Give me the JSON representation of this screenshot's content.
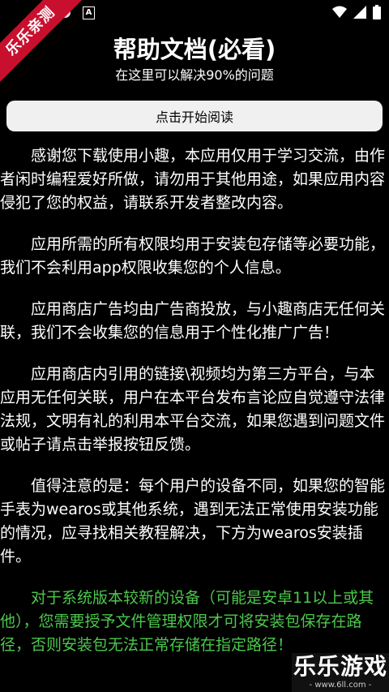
{
  "status_bar": {
    "a_label": "A"
  },
  "ribbon": {
    "text": "乐乐亲测"
  },
  "header": {
    "title": "帮助文档(必看)",
    "subtitle": "在这里可以解决90%的问题"
  },
  "actions": {
    "read_label": "点击开始阅读"
  },
  "paragraphs": [
    "感谢您下载使用小趣，本应用仅用于学习交流，由作者闲时编程爱好所做，请勿用于其他用途，如果应用内容侵犯了您的权益，请联系开发者整改内容。",
    "应用所需的所有权限均用于安装包存储等必要功能，我们不会利用app权限收集您的个人信息。",
    "应用商店广告均由广告商投放，与小趣商店无任何关联，我们不会收集您的信息用于个性化推广广告！",
    "应用商店内引用的链接\\视频均为第三方平台，与本应用无任何关联，用户在本平台发布言论应自觉遵守法律法规，文明有礼的利用本平台交流，如果您遇到问题文件或帖子请点击举报按钮反馈。",
    "值得注意的是：每个用户的设备不同，如果您的智能手表为wearos或其他系统，遇到无法正常使用安装功能的情况，应寻找相关教程解决，下方为wearos安装插件。",
    "对于系统版本较新的设备（可能是安卓11以上或其他），您需要授予文件管理权限才可将安装包保存在路径，否则安装包无法正常存储在指定路径！"
  ],
  "watermark": {
    "main": "乐乐游戏",
    "sub": "- www.6ll.com -"
  },
  "colors": {
    "background": "#000000",
    "highlight_green": "#4cc84c",
    "ribbon_red": "#c8102e"
  }
}
